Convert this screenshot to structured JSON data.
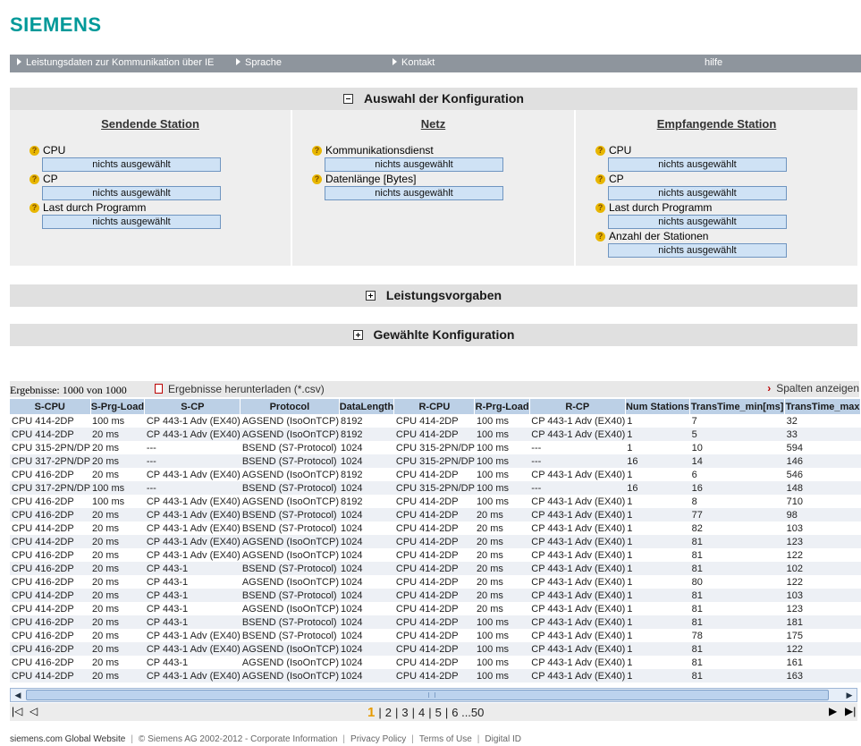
{
  "logo": "SIEMENS",
  "nav": {
    "items": [
      "Leistungsdaten zur Kommunikation über IE",
      "Sprache",
      "Kontakt"
    ],
    "help": "hilfe"
  },
  "sections": {
    "config_title": "Auswahl der Konfiguration",
    "performance_title": "Leistungsvorgaben",
    "selected_title": "Gewählte Konfiguration"
  },
  "sending": {
    "title": "Sendende Station",
    "cpu_label": "CPU",
    "cpu_value": "nichts ausgewählt",
    "cp_label": "CP",
    "cp_value": "nichts ausgewählt",
    "load_label": "Last durch Programm",
    "load_value": "nichts ausgewählt"
  },
  "network": {
    "title": "Netz",
    "service_label": "Kommunikationsdienst",
    "service_value": "nichts ausgewählt",
    "length_label": "Datenlänge [Bytes]",
    "length_value": "nichts ausgewählt"
  },
  "receiving": {
    "title": "Empfangende Station",
    "cpu_label": "CPU",
    "cpu_value": "nichts ausgewählt",
    "cp_label": "CP",
    "cp_value": "nichts ausgewählt",
    "load_label": "Last durch Programm",
    "load_value": "nichts ausgewählt",
    "stations_label": "Anzahl der Stationen",
    "stations_value": "nichts ausgewählt"
  },
  "results": {
    "count": "Ergebnisse: 1000 von 1000",
    "download": "Ergebnisse herunterladen (*.csv)",
    "show_columns": "Spalten anzeigen"
  },
  "table": {
    "headers": [
      "S-CPU",
      "S-Prg-Load",
      "S-CP",
      "Protocol",
      "DataLength",
      "R-CPU",
      "R-Prg-Load",
      "R-CP",
      "Num Stations",
      "TransTime_min[ms]",
      "TransTime_max"
    ],
    "rows": [
      [
        "CPU 414-2DP",
        "100 ms",
        "CP 443-1 Adv (EX40)",
        "AGSEND (IsoOnTCP)",
        "8192",
        "CPU 414-2DP",
        "100 ms",
        "CP 443-1 Adv (EX40)",
        "1",
        "7",
        "32"
      ],
      [
        "CPU 414-2DP",
        "20 ms",
        "CP 443-1 Adv (EX40)",
        "AGSEND (IsoOnTCP)",
        "8192",
        "CPU 414-2DP",
        "100 ms",
        "CP 443-1 Adv (EX40)",
        "1",
        "5",
        "33"
      ],
      [
        "CPU 315-2PN/DP",
        "20 ms",
        "---",
        "BSEND (S7-Protocol)",
        "1024",
        "CPU 315-2PN/DP",
        "100 ms",
        "---",
        "1",
        "10",
        "594"
      ],
      [
        "CPU 317-2PN/DP",
        "20 ms",
        "---",
        "BSEND (S7-Protocol)",
        "1024",
        "CPU 315-2PN/DP",
        "100 ms",
        "---",
        "16",
        "14",
        "146"
      ],
      [
        "CPU 416-2DP",
        "20 ms",
        "CP 443-1 Adv (EX40)",
        "AGSEND (IsoOnTCP)",
        "8192",
        "CPU 414-2DP",
        "100 ms",
        "CP 443-1 Adv (EX40)",
        "1",
        "6",
        "546"
      ],
      [
        "CPU 317-2PN/DP",
        "100 ms",
        "---",
        "BSEND (S7-Protocol)",
        "1024",
        "CPU 315-2PN/DP",
        "100 ms",
        "---",
        "16",
        "16",
        "148"
      ],
      [
        "CPU 416-2DP",
        "100 ms",
        "CP 443-1 Adv (EX40)",
        "AGSEND (IsoOnTCP)",
        "8192",
        "CPU 414-2DP",
        "100 ms",
        "CP 443-1 Adv (EX40)",
        "1",
        "8",
        "710"
      ],
      [
        "CPU 416-2DP",
        "20 ms",
        "CP 443-1 Adv (EX40)",
        "BSEND (S7-Protocol)",
        "1024",
        "CPU 414-2DP",
        "20 ms",
        "CP 443-1 Adv (EX40)",
        "1",
        "77",
        "98"
      ],
      [
        "CPU 414-2DP",
        "20 ms",
        "CP 443-1 Adv (EX40)",
        "BSEND (S7-Protocol)",
        "1024",
        "CPU 414-2DP",
        "20 ms",
        "CP 443-1 Adv (EX40)",
        "1",
        "82",
        "103"
      ],
      [
        "CPU 414-2DP",
        "20 ms",
        "CP 443-1 Adv (EX40)",
        "AGSEND (IsoOnTCP)",
        "1024",
        "CPU 414-2DP",
        "20 ms",
        "CP 443-1 Adv (EX40)",
        "1",
        "81",
        "123"
      ],
      [
        "CPU 416-2DP",
        "20 ms",
        "CP 443-1 Adv (EX40)",
        "AGSEND (IsoOnTCP)",
        "1024",
        "CPU 414-2DP",
        "20 ms",
        "CP 443-1 Adv (EX40)",
        "1",
        "81",
        "122"
      ],
      [
        "CPU 416-2DP",
        "20 ms",
        "CP 443-1",
        "BSEND (S7-Protocol)",
        "1024",
        "CPU 414-2DP",
        "20 ms",
        "CP 443-1 Adv (EX40)",
        "1",
        "81",
        "102"
      ],
      [
        "CPU 416-2DP",
        "20 ms",
        "CP 443-1",
        "AGSEND (IsoOnTCP)",
        "1024",
        "CPU 414-2DP",
        "20 ms",
        "CP 443-1 Adv (EX40)",
        "1",
        "80",
        "122"
      ],
      [
        "CPU 414-2DP",
        "20 ms",
        "CP 443-1",
        "BSEND (S7-Protocol)",
        "1024",
        "CPU 414-2DP",
        "20 ms",
        "CP 443-1 Adv (EX40)",
        "1",
        "81",
        "103"
      ],
      [
        "CPU 414-2DP",
        "20 ms",
        "CP 443-1",
        "AGSEND (IsoOnTCP)",
        "1024",
        "CPU 414-2DP",
        "20 ms",
        "CP 443-1 Adv (EX40)",
        "1",
        "81",
        "123"
      ],
      [
        "CPU 416-2DP",
        "20 ms",
        "CP 443-1",
        "BSEND (S7-Protocol)",
        "1024",
        "CPU 414-2DP",
        "100 ms",
        "CP 443-1 Adv (EX40)",
        "1",
        "81",
        "181"
      ],
      [
        "CPU 416-2DP",
        "20 ms",
        "CP 443-1 Adv (EX40)",
        "BSEND (S7-Protocol)",
        "1024",
        "CPU 414-2DP",
        "100 ms",
        "CP 443-1 Adv (EX40)",
        "1",
        "78",
        "175"
      ],
      [
        "CPU 416-2DP",
        "20 ms",
        "CP 443-1 Adv (EX40)",
        "AGSEND (IsoOnTCP)",
        "1024",
        "CPU 414-2DP",
        "100 ms",
        "CP 443-1 Adv (EX40)",
        "1",
        "81",
        "122"
      ],
      [
        "CPU 416-2DP",
        "20 ms",
        "CP 443-1",
        "AGSEND (IsoOnTCP)",
        "1024",
        "CPU 414-2DP",
        "100 ms",
        "CP 443-1 Adv (EX40)",
        "1",
        "81",
        "161"
      ],
      [
        "CPU 414-2DP",
        "20 ms",
        "CP 443-1 Adv (EX40)",
        "AGSEND (IsoOnTCP)",
        "1024",
        "CPU 414-2DP",
        "100 ms",
        "CP 443-1 Adv (EX40)",
        "1",
        "81",
        "163"
      ]
    ]
  },
  "pager": {
    "current": "1",
    "pages": [
      "2",
      "3",
      "4",
      "5"
    ],
    "last": "6 ...50"
  },
  "footer": {
    "brand": "siemens.com Global Website",
    "links": [
      "© Siemens AG 2002-2012 - Corporate Information",
      "Privacy Policy",
      "Terms of Use",
      "Digital ID"
    ]
  },
  "colors": {
    "brand": "#019999",
    "nav_bg": "#8e959d",
    "header_bg": "#bcd0e6",
    "selector_bg": "#cfe2f5",
    "current_page": "#e69a00"
  }
}
